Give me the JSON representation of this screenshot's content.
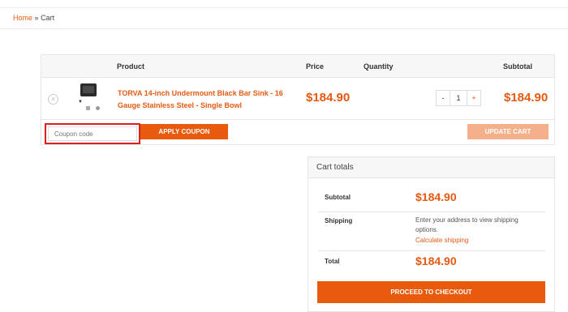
{
  "breadcrumb": {
    "home": "Home",
    "separator": "»",
    "current": "Cart"
  },
  "table": {
    "headers": {
      "product": "Product",
      "price": "Price",
      "quantity": "Quantity",
      "subtotal": "Subtotal"
    },
    "item": {
      "remove_glyph": "×",
      "name": "TORVA 14-inch Undermount Black Bar Sink - 16 Gauge Stainless Steel - Single Bowl",
      "price": "$184.90",
      "qty_minus": "-",
      "qty_value": "1",
      "qty_plus": "+",
      "subtotal": "$184.90"
    }
  },
  "coupon": {
    "placeholder": "Coupon code",
    "apply_label": "APPLY COUPON"
  },
  "update_label": "UPDATE CART",
  "totals": {
    "title": "Cart totals",
    "subtotal_label": "Subtotal",
    "subtotal_value": "$184.90",
    "shipping_label": "Shipping",
    "shipping_text": "Enter your address to view shipping options.",
    "calc_link": "Calculate shipping",
    "total_label": "Total",
    "total_value": "$184.90",
    "checkout_label": "PROCEED TO CHECKOUT"
  },
  "colors": {
    "accent": "#e85b0c",
    "accent_text": "#e45a12",
    "update_disabled": "#f4b08a",
    "highlight_border": "#d9201e"
  },
  "icons": {
    "remove": "close-circle-icon",
    "thumb_arrow": "arrow-down-icon"
  }
}
